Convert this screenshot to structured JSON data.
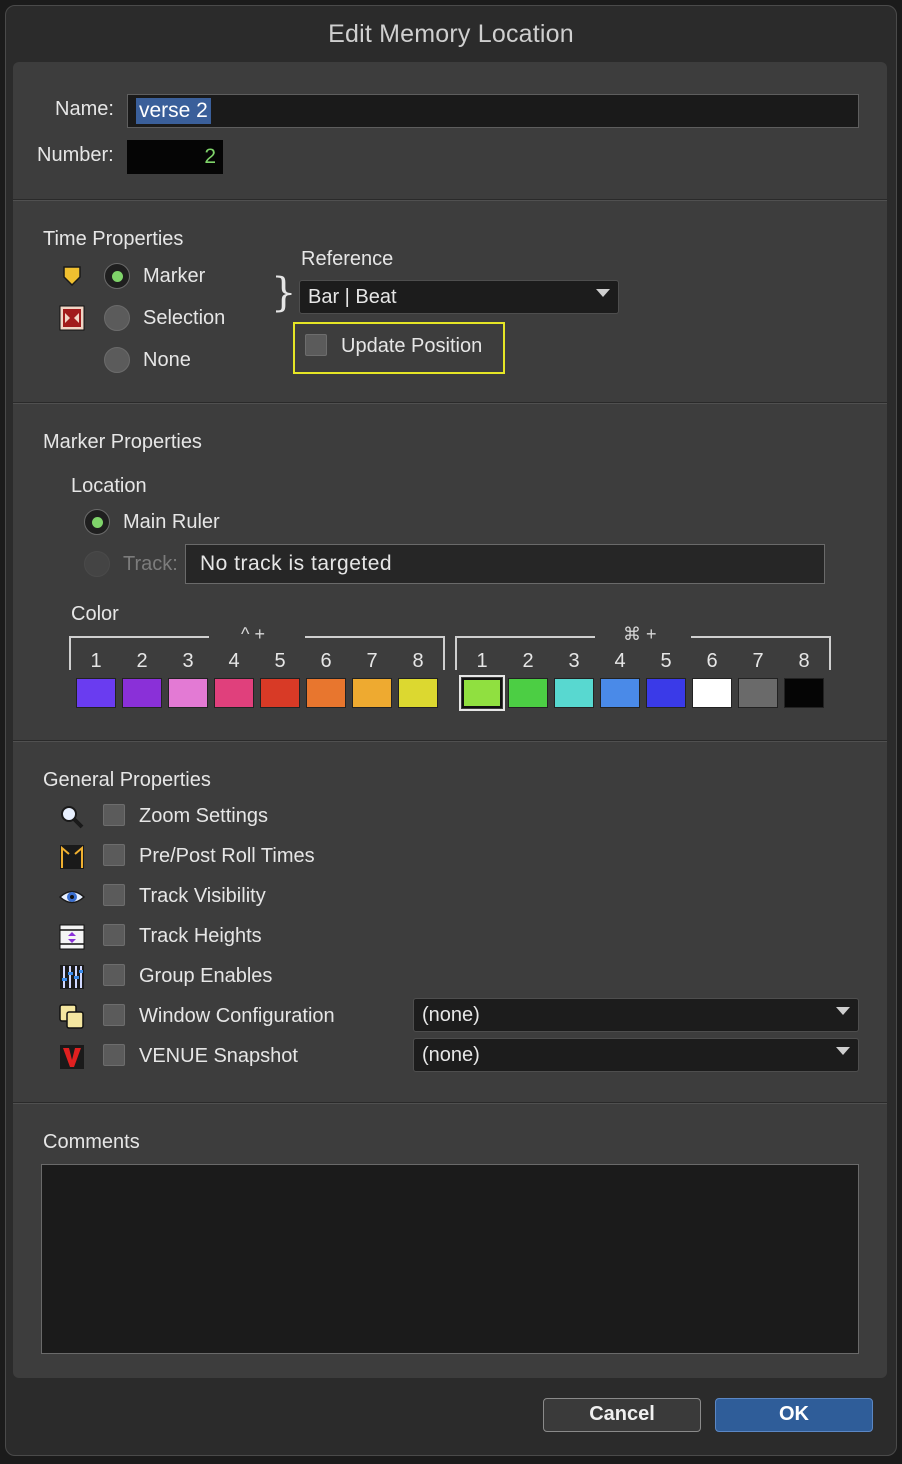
{
  "window": {
    "title": "Edit Memory Location"
  },
  "name": {
    "label": "Name:",
    "value": "verse 2"
  },
  "number": {
    "label": "Number:",
    "value": "2"
  },
  "time_properties": {
    "heading": "Time Properties",
    "options": [
      "Marker",
      "Selection",
      "None"
    ],
    "selected": "Marker",
    "reference_label": "Reference",
    "reference_value": "Bar | Beat",
    "update_position_label": "Update Position"
  },
  "marker_properties": {
    "heading": "Marker Properties",
    "location_label": "Location",
    "main_ruler_label": "Main Ruler",
    "track_label": "Track:",
    "track_value": "No track is targeted",
    "color_label": "Color",
    "group1_modifier": "^ +",
    "group2_modifier": "⌘ +",
    "numbers": [
      "1",
      "2",
      "3",
      "4",
      "5",
      "6",
      "7",
      "8"
    ],
    "group1_colors": [
      "#6a3cf0",
      "#8a30d8",
      "#e37ad4",
      "#e0407c",
      "#d83a26",
      "#e8762e",
      "#eeaa30",
      "#dcd830"
    ],
    "group2_colors": [
      "#90e040",
      "#4cce44",
      "#58d8d0",
      "#4a8ae8",
      "#3a3ae8",
      "#ffffff",
      "#6a6a6a",
      "#050505"
    ],
    "selected_color": "group2-1"
  },
  "general_properties": {
    "heading": "General Properties",
    "items": [
      {
        "label": "Zoom Settings",
        "icon": "magnifier-icon"
      },
      {
        "label": "Pre/Post Roll Times",
        "icon": "pre-post-roll-icon"
      },
      {
        "label": "Track Visibility",
        "icon": "eye-icon"
      },
      {
        "label": "Track Heights",
        "icon": "track-heights-icon"
      },
      {
        "label": "Group Enables",
        "icon": "group-enables-icon"
      },
      {
        "label": "Window Configuration",
        "icon": "window-config-icon"
      },
      {
        "label": "VENUE Snapshot",
        "icon": "venue-icon"
      }
    ],
    "window_config_value": "(none)",
    "venue_snapshot_value": "(none)"
  },
  "comments": {
    "heading": "Comments",
    "value": ""
  },
  "buttons": {
    "cancel": "Cancel",
    "ok": "OK"
  }
}
